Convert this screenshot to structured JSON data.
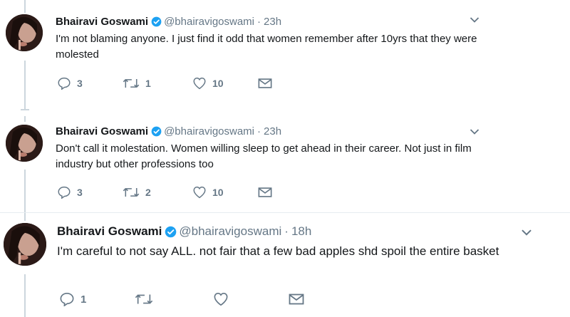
{
  "tweets": [
    {
      "author_name": "Bhairavi Goswami",
      "author_handle": "@bhairavigoswami",
      "separator": "·",
      "timestamp": "23h",
      "text": "I'm not blaming anyone. I just find it odd that women remember after 10yrs that they were molested",
      "replies": "3",
      "retweets": "1",
      "likes": "10"
    },
    {
      "author_name": "Bhairavi Goswami",
      "author_handle": "@bhairavigoswami",
      "separator": "·",
      "timestamp": "23h",
      "text": "Don't call it molestation. Women willing sleep to get ahead in their career. Not just in film industry but other professions too",
      "replies": "3",
      "retweets": "2",
      "likes": "10"
    },
    {
      "author_name": "Bhairavi Goswami",
      "author_handle": "@bhairavigoswami",
      "separator": "·",
      "timestamp": "18h",
      "text": "I'm careful to not say ALL. not fair that a few bad apples shd spoil the entire basket",
      "replies": "1",
      "retweets": "",
      "likes": ""
    }
  ],
  "icons": {
    "verified": "verified-badge-icon",
    "reply": "reply-icon",
    "retweet": "retweet-icon",
    "like": "heart-icon",
    "message": "envelope-icon",
    "more": "chevron-down-icon"
  },
  "colors": {
    "verified": "#1da1f2",
    "icon_gray": "#657786",
    "thread_line": "#ccd6dd"
  }
}
